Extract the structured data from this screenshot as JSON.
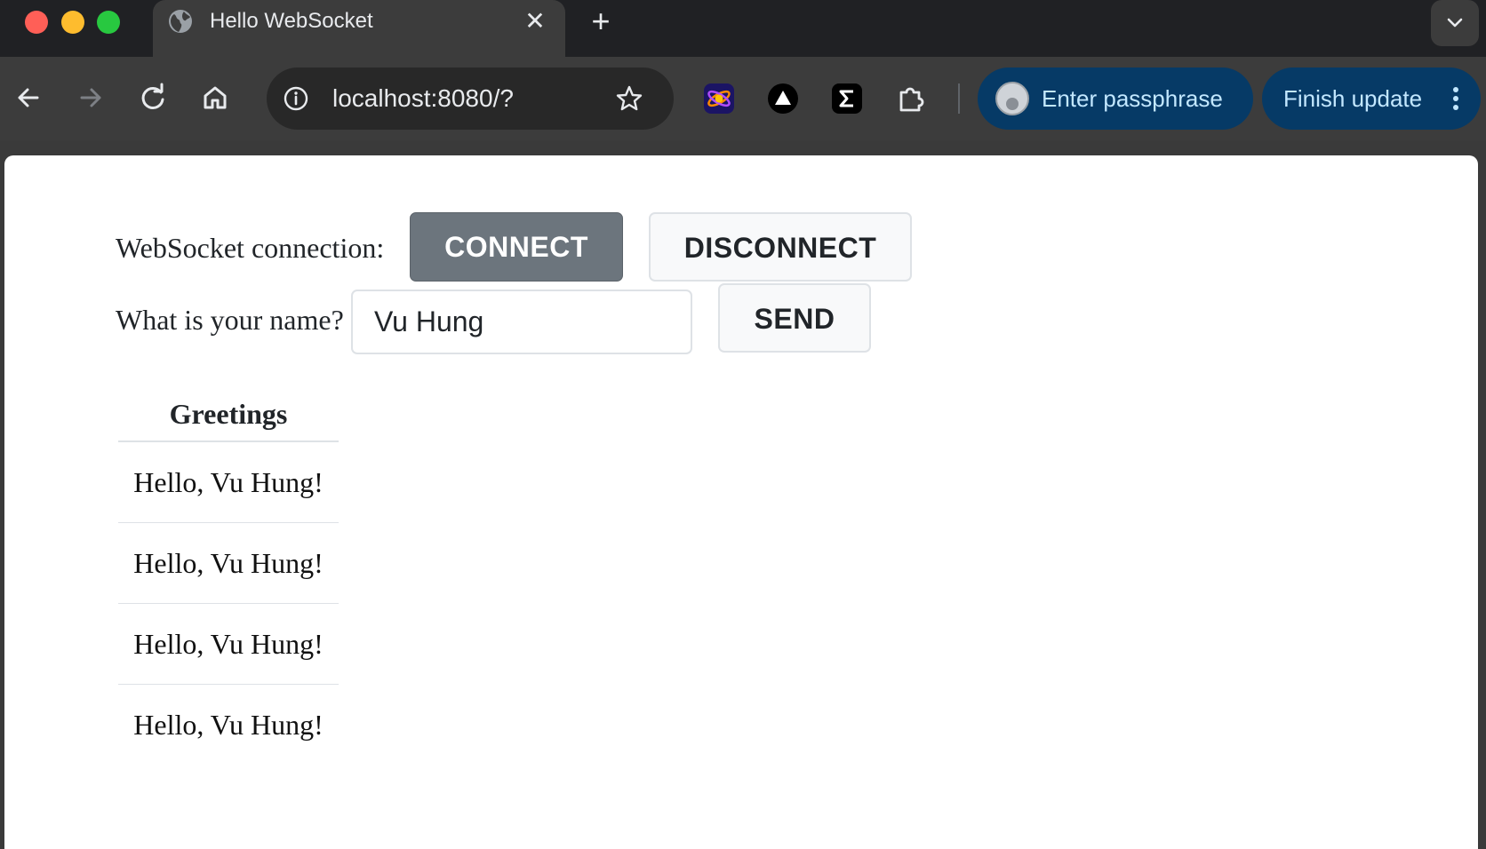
{
  "browser": {
    "tab": {
      "title": "Hello WebSocket",
      "favicon": "globe-icon",
      "close": "✕"
    },
    "new_tab": "+",
    "address_bar": {
      "url": "localhost:8080/?"
    },
    "extensions": [
      "orbit-extension-icon",
      "triangle-extension-icon",
      "sigma-extension-icon",
      "puzzle-extensions-icon"
    ],
    "profile_pill": {
      "label": "Enter passphrase"
    },
    "update_pill": {
      "label": "Finish update"
    },
    "colors": {
      "pill_bg": "#063a66",
      "pill_text": "#c2e7ff",
      "chrome_dark": "#202124",
      "toolbar": "#3c3c3c"
    }
  },
  "page": {
    "connection_label": "WebSocket connection:",
    "connect_label": "CONNECT",
    "disconnect_label": "DISCONNECT",
    "name_label": "What is your name?",
    "name_value": "Vu Hung",
    "send_label": "SEND",
    "greetings_header": "Greetings",
    "greetings": [
      "Hello, Vu Hung!",
      "Hello, Vu Hung!",
      "Hello, Vu Hung!",
      "Hello, Vu Hung!"
    ],
    "colors": {
      "connect_bg": "#6c757d",
      "secondary_bg": "#f8f9fa"
    }
  }
}
